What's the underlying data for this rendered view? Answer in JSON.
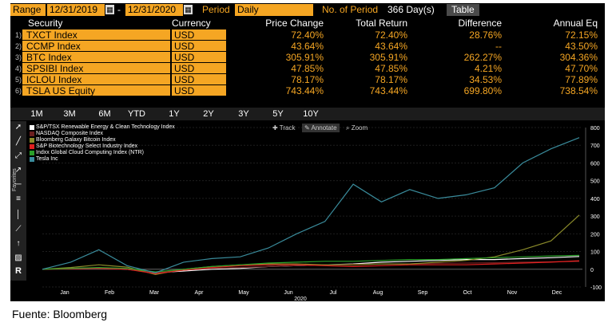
{
  "range_bar": {
    "range_label": "Range",
    "start_date": "12/31/2019",
    "end_date": "12/31/2020",
    "period_label": "Period",
    "period_value": "Daily",
    "no_of_period_label": "No. of Period",
    "no_of_period_value": "366 Day(s)",
    "table_button": "Table"
  },
  "table": {
    "headers": {
      "security": "Security",
      "currency": "Currency",
      "price_change": "Price Change",
      "total_return": "Total Return",
      "difference": "Difference",
      "annual_eq": "Annual Eq"
    },
    "rows": [
      {
        "n": "1)",
        "security": "TXCT Index",
        "currency": "USD",
        "price_change": "72.40%",
        "total_return": "72.40%",
        "difference": "28.76%",
        "annual_eq": "72.15%"
      },
      {
        "n": "2)",
        "security": "CCMP Index",
        "currency": "USD",
        "price_change": "43.64%",
        "total_return": "43.64%",
        "difference": "--",
        "annual_eq": "43.50%"
      },
      {
        "n": "3)",
        "security": "BTC Index",
        "currency": "USD",
        "price_change": "305.91%",
        "total_return": "305.91%",
        "difference": "262.27%",
        "annual_eq": "304.36%"
      },
      {
        "n": "4)",
        "security": "SPSIBI Index",
        "currency": "USD",
        "price_change": "47.85%",
        "total_return": "47.85%",
        "difference": "4.21%",
        "annual_eq": "47.70%"
      },
      {
        "n": "5)",
        "security": "ICLOU Index",
        "currency": "USD",
        "price_change": "78.17%",
        "total_return": "78.17%",
        "difference": "34.53%",
        "annual_eq": "77.89%"
      },
      {
        "n": "6)",
        "security": "TSLA US Equity",
        "currency": "USD",
        "price_change": "743.44%",
        "total_return": "743.44%",
        "difference": "699.80%",
        "annual_eq": "738.54%"
      }
    ]
  },
  "periods": [
    "1M",
    "3M",
    "6M",
    "YTD",
    "1Y",
    "2Y",
    "3Y",
    "5Y",
    "10Y"
  ],
  "chart_toolbar": {
    "track": "Track",
    "annotate": "Annotate",
    "zoom": "Zoom"
  },
  "side_tools": {
    "favorites": "Favorites",
    "r_label": "R"
  },
  "legend": [
    {
      "name": "S&P/TSX Renewable Energy & Clean Technology Index",
      "color": "#ffffff"
    },
    {
      "name": "NASDAQ Composite Index",
      "color": "#6b1f1f"
    },
    {
      "name": "Bloomberg Galaxy Bitcoin Index",
      "color": "#8a8a2a"
    },
    {
      "name": "S&P Biotechnology Select Industry Index",
      "color": "#e02020"
    },
    {
      "name": "Indxx Global Cloud Computing Index (NTR)",
      "color": "#2aa02a"
    },
    {
      "name": "Tesla Inc",
      "color": "#3a8c9c"
    }
  ],
  "chart_data": {
    "type": "line",
    "x_labels": [
      "Jan",
      "Feb",
      "Mar",
      "Apr",
      "May",
      "Jun",
      "Jul",
      "Aug",
      "Sep",
      "Oct",
      "Nov",
      "Dec"
    ],
    "year_label": "2020",
    "y_ticks": [
      -100,
      0,
      100,
      200,
      300,
      400,
      500,
      600,
      700,
      800
    ],
    "ylim": [
      -100,
      800
    ],
    "series": [
      {
        "name": "S&P/TSX Renewable Energy & Clean Technology Index",
        "color": "#ffffff",
        "values": [
          0,
          5,
          8,
          0,
          -20,
          -10,
          0,
          5,
          15,
          20,
          25,
          30,
          40,
          45,
          50,
          55,
          55,
          60,
          65,
          72
        ]
      },
      {
        "name": "NASDAQ Composite Index",
        "color": "#6b1f1f",
        "values": [
          0,
          4,
          7,
          3,
          -20,
          -5,
          5,
          10,
          15,
          20,
          25,
          28,
          30,
          30,
          33,
          35,
          37,
          40,
          42,
          44
        ]
      },
      {
        "name": "Bloomberg Galaxy Bitcoin Index",
        "color": "#8a8a2a",
        "values": [
          0,
          10,
          25,
          12,
          -30,
          0,
          15,
          25,
          30,
          30,
          25,
          25,
          30,
          30,
          40,
          50,
          70,
          110,
          160,
          306
        ]
      },
      {
        "name": "S&P Biotechnology Select Industry Index",
        "color": "#e02020",
        "values": [
          0,
          2,
          5,
          0,
          -25,
          -5,
          10,
          20,
          25,
          25,
          20,
          15,
          20,
          25,
          25,
          25,
          30,
          35,
          40,
          48
        ]
      },
      {
        "name": "Indxx Global Cloud Computing Index (NTR)",
        "color": "#2aa02a",
        "values": [
          0,
          5,
          10,
          5,
          -15,
          0,
          15,
          25,
          35,
          40,
          45,
          45,
          50,
          55,
          55,
          60,
          65,
          70,
          75,
          78
        ]
      },
      {
        "name": "Tesla Inc",
        "color": "#3a8c9c",
        "values": [
          0,
          40,
          110,
          20,
          -20,
          40,
          60,
          70,
          120,
          200,
          270,
          480,
          380,
          450,
          400,
          420,
          460,
          600,
          680,
          743
        ]
      }
    ]
  },
  "source": "Fuente: Bloomberg"
}
